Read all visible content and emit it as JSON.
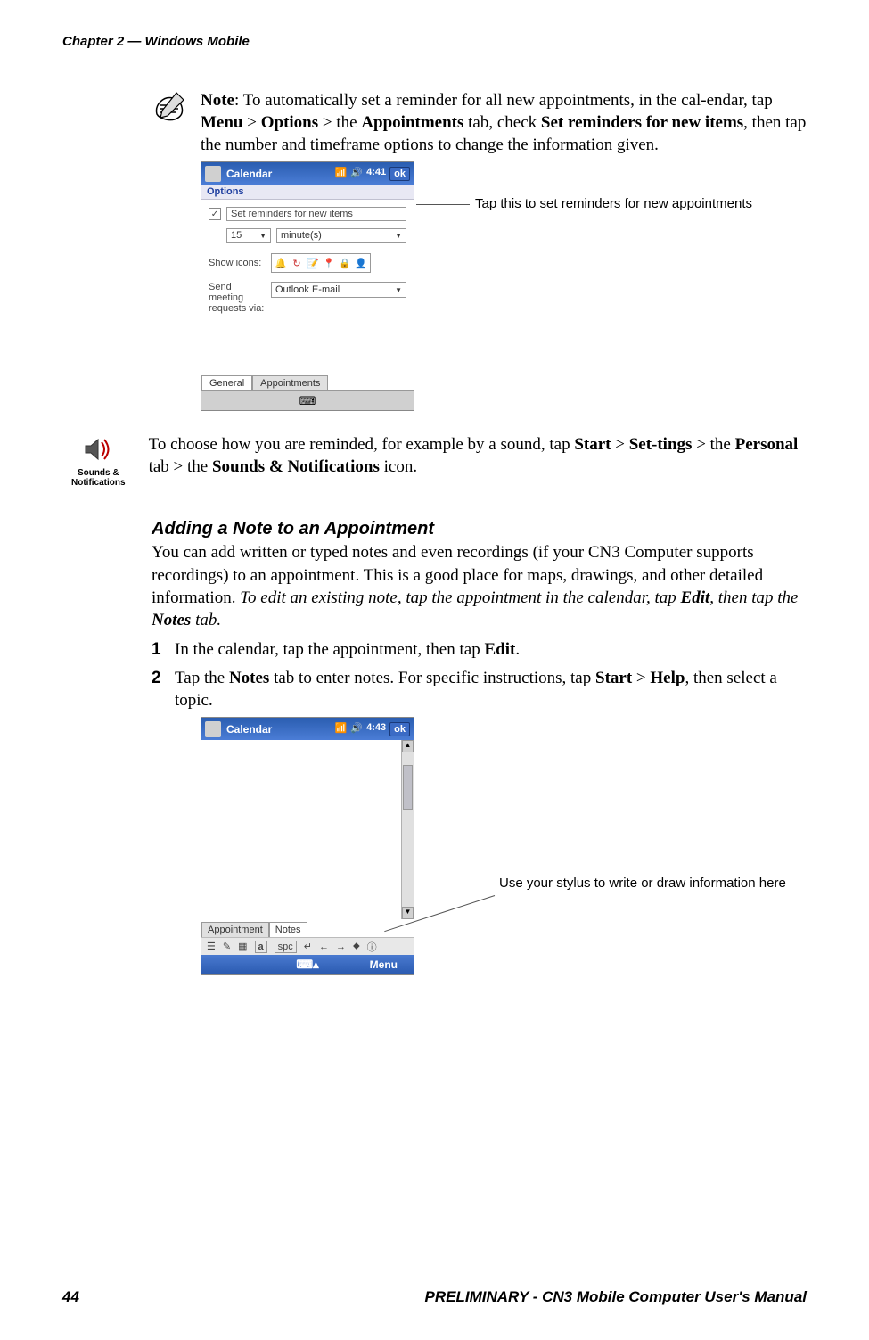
{
  "header": {
    "chapter": "Chapter 2 — Windows Mobile"
  },
  "footer": {
    "page": "44",
    "manual": "PRELIMINARY - CN3 Mobile Computer User's Manual"
  },
  "note": {
    "prefix": "Note",
    "t1": ": To automatically set a reminder for all new appointments, in the cal-endar, tap ",
    "b1": "Menu",
    "g1": " > ",
    "b2": "Options",
    "g2": " > the ",
    "b3": "Appointments",
    "t2": " tab, check ",
    "b4": "Set reminders for new items",
    "t3": ", then tap the number and timeframe options to change the information given."
  },
  "phone1": {
    "title": "Calendar",
    "time": "4:41",
    "ok": "ok",
    "section": "Options",
    "check_label": "Set reminders for new items",
    "num": "15",
    "unit": "minute(s)",
    "showicons": "Show icons:",
    "sendreq1": "Send meeting",
    "sendreq2": "requests via:",
    "outlook": "Outlook E-mail",
    "tab_general": "General",
    "tab_appts": "Appointments"
  },
  "callout1": "Tap this to set reminders for new appointments",
  "sounds": {
    "label1": "Sounds &",
    "label2": "Notifications",
    "t1": "To choose how you are reminded, for example by a sound, tap ",
    "b1": "Start",
    "g1": " > ",
    "b2": "Set-tings",
    "g2": " > the ",
    "b3": "Personal",
    "t2": " tab > the ",
    "b4": "Sounds & Notifications",
    "t3": " icon."
  },
  "adding": {
    "heading": "Adding a Note to an Appointment",
    "p1a": "You can add written or typed notes and even recordings (if your CN3 Computer supports recordings) to an appointment. This is a good place for maps, drawings, and other detailed information. ",
    "p1b_i": "To edit an existing note, tap the appointment in the calendar, tap ",
    "p1b_b": "Edit",
    "p1b_i2": ", then tap the ",
    "p1b_b2": "Notes",
    "p1b_i3": " tab.",
    "step1_num": "1",
    "step1a": "In the calendar, tap the appointment, then tap ",
    "step1b": "Edit",
    "step1c": ".",
    "step2_num": "2",
    "step2a": "Tap the ",
    "step2b": "Notes",
    "step2c": " tab to enter notes. For specific instructions, tap ",
    "step2d": "Start",
    "step2e": " > ",
    "step2f": "Help",
    "step2g": ", then select a topic."
  },
  "phone2": {
    "title": "Calendar",
    "time": "4:43",
    "ok": "ok",
    "tab_appt": "Appointment",
    "tab_notes": "Notes",
    "sip_a": "a",
    "sip_spc": "spc",
    "menu": "Menu"
  },
  "callout2": "Use your stylus to write or draw information here"
}
